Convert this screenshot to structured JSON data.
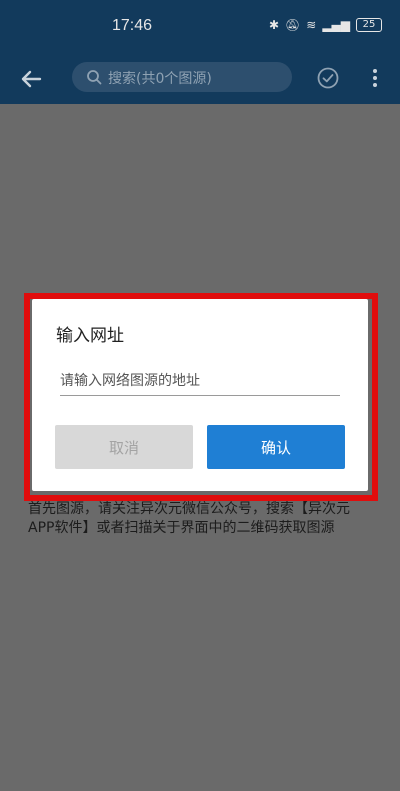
{
  "status_bar": {
    "time": "17:46",
    "battery": "25"
  },
  "toolbar": {
    "search_placeholder": "搜索(共0个图源)",
    "back_icon": "arrow-left-icon",
    "search_icon": "search-icon",
    "check_icon": "check-circle-icon",
    "more_icon": "more-vertical-icon"
  },
  "background": {
    "hint": "首先图源，请关注异次元微信公众号，搜索【异次元APP软件】或者扫描关于界面中的二维码获取图源"
  },
  "dialog": {
    "title": "输入网址",
    "input_placeholder": "请输入网络图源的地址",
    "input_value": "",
    "cancel_label": "取消",
    "confirm_label": "确认"
  },
  "colors": {
    "toolbar_bg": "#123a5c",
    "overlay": "#6a6a6a",
    "highlight": "#e00d0d",
    "confirm_bg": "#1f7fd4",
    "cancel_bg": "#d8d8d8"
  }
}
